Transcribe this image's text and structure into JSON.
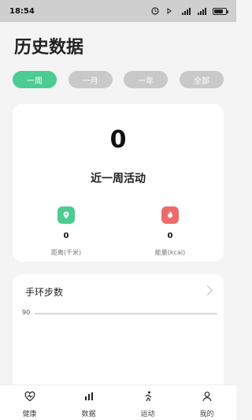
{
  "status_bar": {
    "time": "18:54"
  },
  "page": {
    "title": "历史数据"
  },
  "tabs": [
    {
      "label": "一周",
      "active": true
    },
    {
      "label": "一月",
      "active": false
    },
    {
      "label": "一年",
      "active": false
    },
    {
      "label": "全部",
      "active": false
    }
  ],
  "summary": {
    "total_value": "0",
    "label": "近一周活动",
    "metrics": [
      {
        "value": "0",
        "label": "距离(千米)",
        "icon": "distance-pin-icon",
        "color": "#4ccb93"
      },
      {
        "value": "0",
        "label": "能量(kcal)",
        "icon": "flame-icon",
        "color": "#ee6b6b"
      }
    ]
  },
  "steps_card": {
    "title": "手环步数",
    "axis_value": "90"
  },
  "bottom_nav": [
    {
      "label": "健康",
      "icon": "heart-pulse-icon"
    },
    {
      "label": "数据",
      "icon": "data-icon"
    },
    {
      "label": "运动",
      "icon": "sport-icon"
    },
    {
      "label": "我的",
      "icon": "profile-icon"
    }
  ],
  "colors": {
    "accent": "#4ccb93",
    "energy": "#ee6b6b",
    "inactive_tab": "#c9c9c9"
  }
}
